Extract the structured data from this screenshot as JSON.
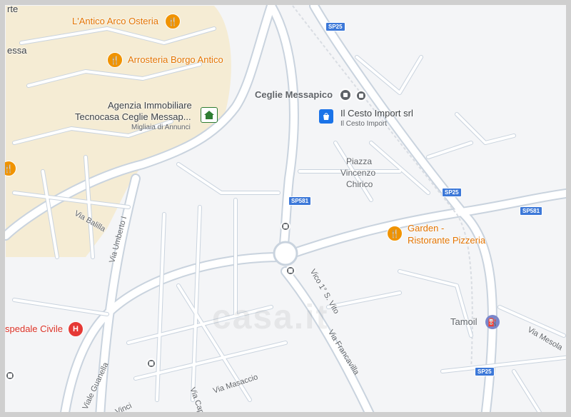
{
  "map": {
    "colors": {
      "background": "#f4f5f7",
      "old_town": "#f5ecd4",
      "road": "#ffffff",
      "road_edge": "#c9d3de",
      "poi_orange": "#e37400",
      "shield": "#3c78d8"
    }
  },
  "pois": {
    "antico_arco": "L'Antico Arco Osteria",
    "arrosteria": "Arrosteria Borgo Antico",
    "agenzia_line1": "Agenzia Immobiliare",
    "agenzia_line2": "Tecnocasa Ceglie Messap...",
    "agenzia_sub": "Migliaia di Annunci",
    "ceglie_station": "Ceglie Messapico",
    "cesto_import": "Il Cesto Import srl",
    "cesto_import_sub": "Il Cesto Import",
    "garden_line1": "Garden -",
    "garden_line2": "Ristorante Pizzeria",
    "tamoil": "Tamoil",
    "ospedale": "spedale Civile",
    "top_left_fragment": "essa",
    "top_left_fragment2": "rte"
  },
  "places": {
    "piazza_line1": "Piazza",
    "piazza_line2": "Vincenzo",
    "piazza_line3": "Chirico"
  },
  "roads": {
    "via_balilla": "Via Balilla",
    "via_umberto": "Via Umberto I",
    "vico_s_vito": "Vico 1° S. Vito",
    "via_francavilla": "Via Francavilla",
    "via_mesola": "Via Mesola",
    "viale_guanella": "Viale Guanella",
    "via_masaccio": "Via Masaccio",
    "via_capo": "Via Capo",
    "via_da_vinci": "Da Vinci"
  },
  "shields": {
    "sp25_top": "SP25",
    "sp581_mid": "SP581",
    "sp25_right": "SP25",
    "sp581_right": "SP581",
    "sp25_bottom": "SP25"
  },
  "watermark": "casa.it",
  "icons": {
    "restaurant": "restaurant-icon",
    "hospital": "hospital-icon",
    "shopping": "shopping-bag-icon",
    "fuel": "fuel-icon",
    "transit": "bus-icon",
    "real_estate": "home-icon"
  }
}
